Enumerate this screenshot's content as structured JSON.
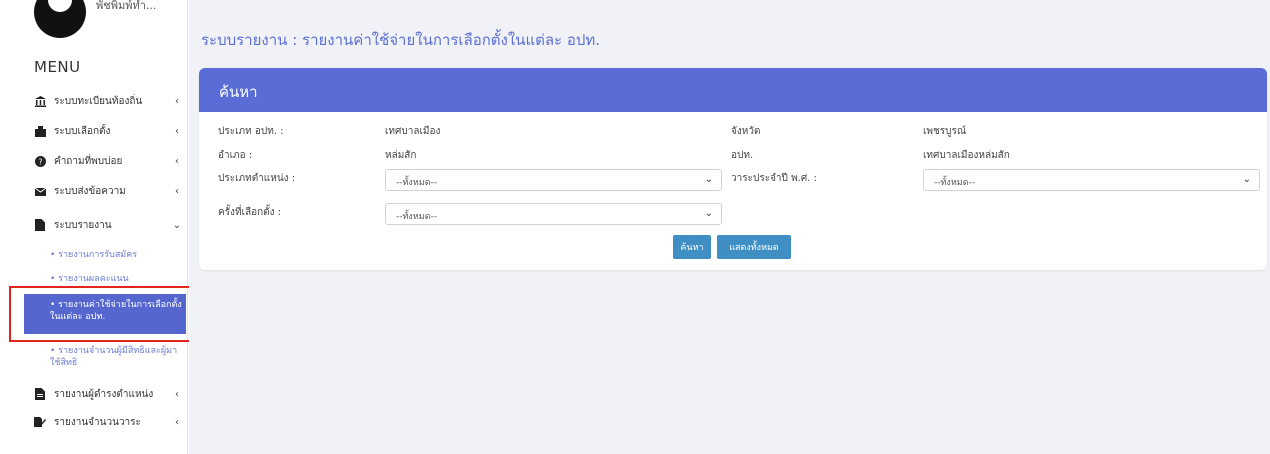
{
  "sidebar": {
    "user_name": "พัชพิมพ์ทำ...",
    "menu_title": "MENU",
    "items": [
      {
        "label": "ระบบทะเบียนท้องถิ่น",
        "icon": "bank-icon",
        "chev": "‹"
      },
      {
        "label": "ระบบเลือกตั้ง",
        "icon": "ballot-icon",
        "chev": "‹"
      },
      {
        "label": "คำถามที่พบบ่อย",
        "icon": "question-icon",
        "chev": "‹"
      },
      {
        "label": "ระบบส่งข้อความ",
        "icon": "envelope-icon",
        "chev": "‹"
      },
      {
        "label": "ระบบรายงาน",
        "icon": "file-icon",
        "chev": "⌄"
      },
      {
        "label": "รายงานผู้ดำรงตำแหน่ง",
        "icon": "file-icon",
        "chev": "‹"
      },
      {
        "label": "รายงานจำนวนวาระ",
        "icon": "edit-file-icon",
        "chev": "‹"
      }
    ],
    "sub_items": {
      "candidates": "• รายงานการรับสมัคร",
      "results": "• รายงานผลคะแนน",
      "expenses": "• รายงานค่าใช้จ่ายในการเลือกตั้งในแต่ละ อปท.",
      "voters": "• รายงานจำนวนผู้มีสิทธิและผู้มาใช้สิทธิ"
    }
  },
  "main": {
    "title": "ระบบรายงาน : รายงานค่าใช้จ่ายในการเลือกตั้งในแต่ละ อปท.",
    "card_title": "ค้นหา",
    "fields": {
      "org_type_label": "ประเภท อปท. :",
      "org_type_value": "เทศบาลเมือง",
      "province_label": "จังหวัด",
      "province_value": "เพชรบูรณ์",
      "district_label": "อำเภอ :",
      "district_value": "หล่มสัก",
      "org_label": "อปท.",
      "org_value": "เทศบาลเมืองหล่มสัก",
      "position_type_label": "ประเภทตำแหน่ง :",
      "position_type_value": "--ทั้งหมด--",
      "term_label": "วาระประจำปี พ.ศ. :",
      "term_value": "--ทั้งหมด--",
      "election_no_label": "ครั้งที่เลือกตั้ง :",
      "election_no_value": "--ทั้งหมด--"
    },
    "buttons": {
      "search": "ค้นหา",
      "show_all": "แสดงทั้งหมด"
    }
  },
  "colors": {
    "accent": "#5a6dd6",
    "button": "#3f8fc4",
    "highlight": "#e3251e"
  }
}
